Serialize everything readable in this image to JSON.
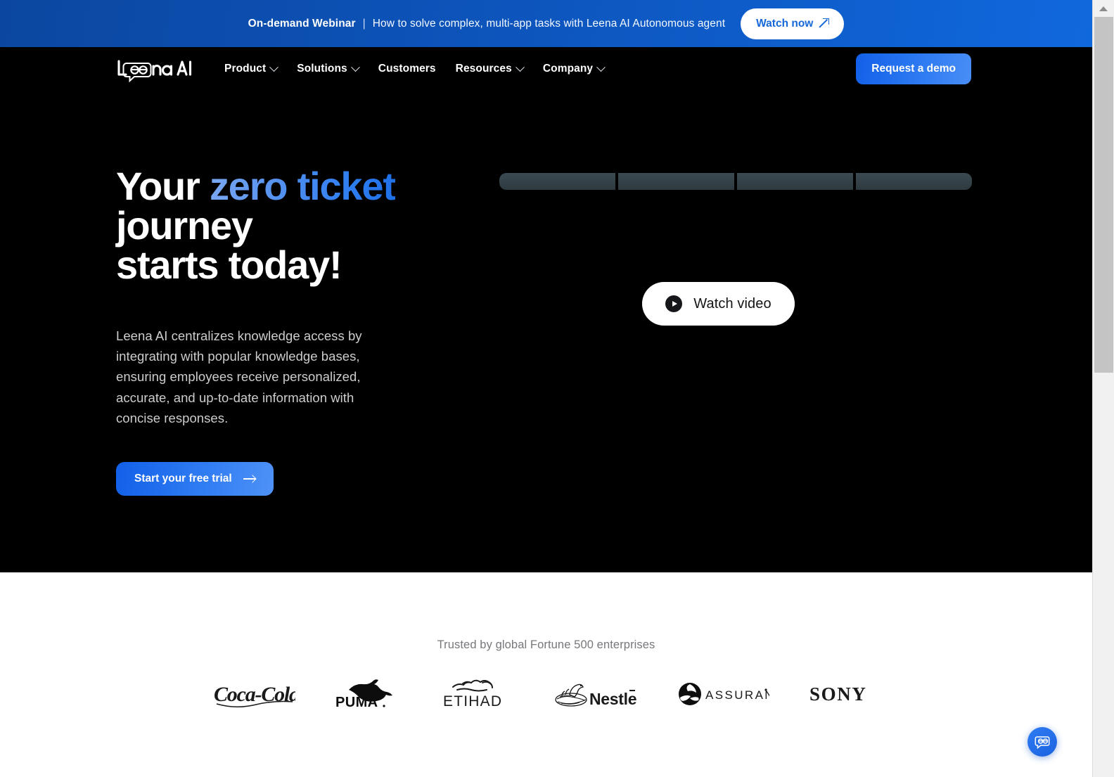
{
  "banner": {
    "strong": "On-demand Webinar",
    "separator": "|",
    "text": "How to solve complex, multi-app tasks with Leena AI Autonomous agent",
    "cta_label": "Watch now",
    "cta_icon": "arrow-up-right-icon",
    "gradient_from": "#0b47a0",
    "gradient_to": "#1068dd"
  },
  "nav": {
    "logo_text": "Leena AI",
    "items": [
      {
        "label": "Product",
        "has_dropdown": true
      },
      {
        "label": "Solutions",
        "has_dropdown": true
      },
      {
        "label": "Customers",
        "has_dropdown": false
      },
      {
        "label": "Resources",
        "has_dropdown": true
      },
      {
        "label": "Company",
        "has_dropdown": true
      }
    ],
    "cta_label": "Request a demo",
    "cta_color": "#1f6fe8"
  },
  "hero": {
    "heading_line1_plain": "Your ",
    "heading_line1_highlight": "zero ticket",
    "heading_line2": "journey",
    "heading_line3": "starts today!",
    "highlight_color": "#4a8ef6",
    "paragraph": "Leena AI centralizes knowledge access by integrating with popular knowledge bases, ensuring employees receive personalized, accurate, and up-to-date information with concise responses.",
    "cta_label": "Start your free trial",
    "cta_icon": "arrow-right-icon",
    "video_button_label": "Watch video",
    "video_button_icon": "play-circle-icon",
    "skeleton_bar_count": 4,
    "background_color": "#000000"
  },
  "trusted": {
    "title": "Trusted by global Fortune 500 enterprises",
    "logos": [
      {
        "name": "coca-cola",
        "label": "Coca-Cola"
      },
      {
        "name": "puma",
        "label": "PUMA"
      },
      {
        "name": "etihad",
        "label": "ETIHAD"
      },
      {
        "name": "nestle",
        "label": "Nestle"
      },
      {
        "name": "assurant",
        "label": "ASSURANT"
      },
      {
        "name": "sony",
        "label": "SONY"
      }
    ]
  },
  "chat_widget": {
    "icon": "chat-bubble-icon",
    "color": "#1b62e0"
  }
}
